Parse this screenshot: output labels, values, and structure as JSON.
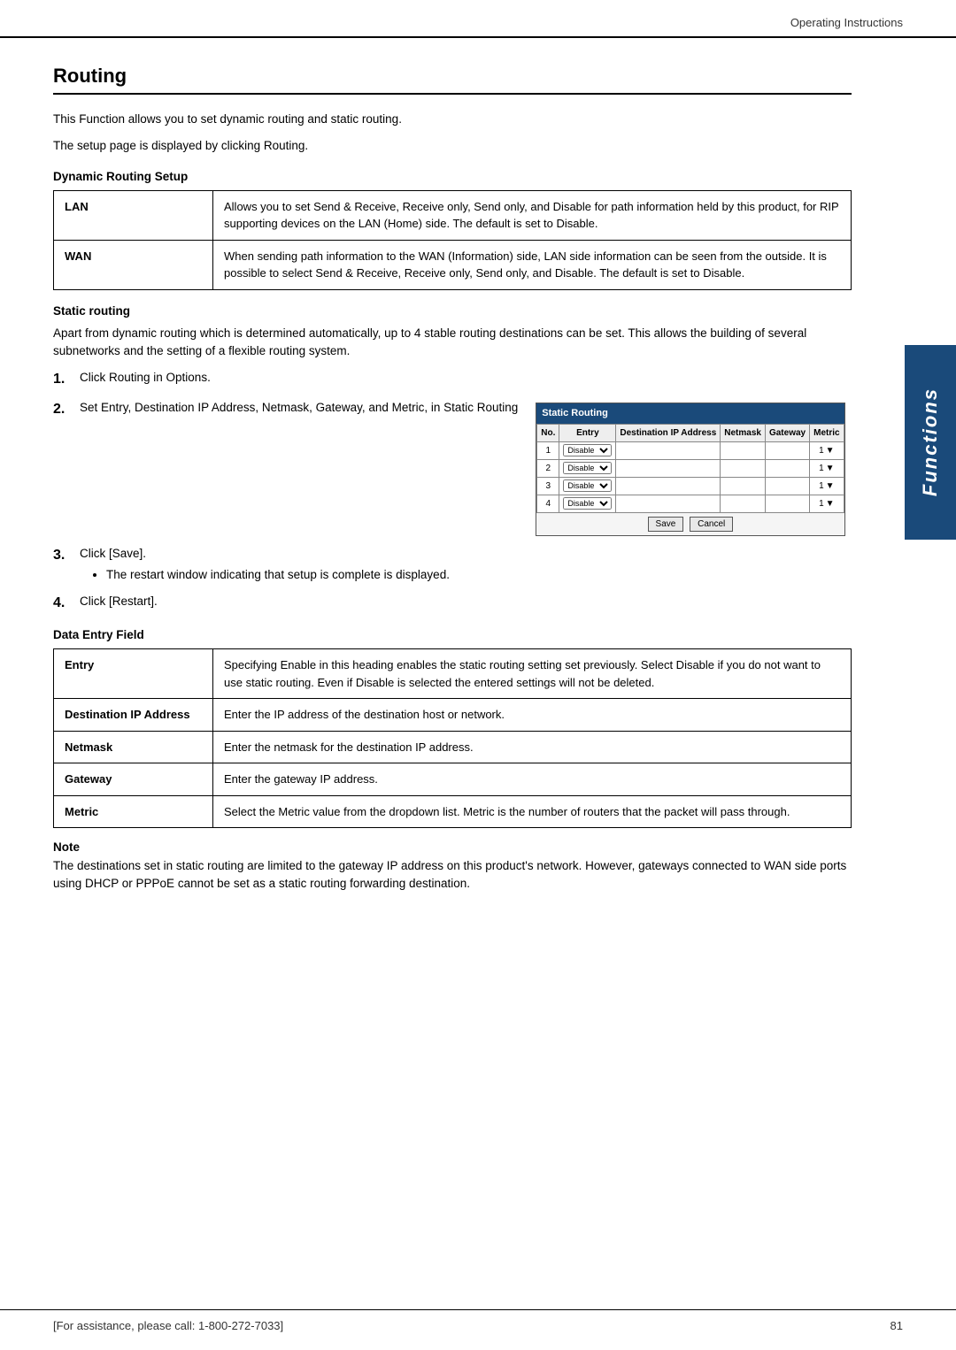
{
  "header": {
    "title": "Operating Instructions"
  },
  "side_tab": {
    "label": "Functions"
  },
  "page": {
    "title": "Routing",
    "intro1": "This Function allows you to set dynamic routing and static routing.",
    "intro2": "The setup page is displayed by clicking Routing."
  },
  "dynamic_routing": {
    "heading": "Dynamic Routing Setup",
    "rows": [
      {
        "label": "LAN",
        "description": "Allows you to set Send & Receive, Receive only, Send only, and Disable for path information held by this product, for RIP supporting devices on the LAN (Home) side. The default is set to Disable."
      },
      {
        "label": "WAN",
        "description": "When sending path information to the WAN (Information) side, LAN side information can be seen from the outside. It is possible to select Send & Receive, Receive only, Send only, and Disable. The default is set to Disable."
      }
    ]
  },
  "static_routing": {
    "heading": "Static routing",
    "description": "Apart from dynamic routing which is determined automatically, up to 4 stable routing destinations can be set. This allows the building of several subnetworks and the setting of a flexible routing system.",
    "steps": [
      {
        "number": "1.",
        "text": "Click Routing in Options."
      },
      {
        "number": "2.",
        "text": "Set Entry, Destination IP Address, Netmask, Gateway, and Metric, in Static Routing"
      },
      {
        "number": "3.",
        "text": "Click [Save].",
        "bullet": "The restart window indicating that setup is complete is displayed."
      },
      {
        "number": "4.",
        "text": "Click [Restart]."
      }
    ],
    "mini_table": {
      "title": "Static Routing",
      "columns": [
        "No.",
        "Entry",
        "Destination IP Address",
        "Netmask",
        "Gateway",
        "Metric"
      ],
      "rows": [
        {
          "no": "1",
          "entry": "Disable",
          "dest": "",
          "netmask": "",
          "gateway": "",
          "metric": "1"
        },
        {
          "no": "2",
          "entry": "Disable",
          "dest": "",
          "netmask": "",
          "gateway": "",
          "metric": "1"
        },
        {
          "no": "3",
          "entry": "Disable",
          "dest": "",
          "netmask": "",
          "gateway": "",
          "metric": "1"
        },
        {
          "no": "4",
          "entry": "Disable",
          "dest": "",
          "netmask": "",
          "gateway": "",
          "metric": "1"
        }
      ],
      "save_btn": "Save",
      "cancel_btn": "Cancel"
    }
  },
  "data_entry": {
    "heading": "Data Entry Field",
    "rows": [
      {
        "label": "Entry",
        "description": "Specifying Enable in this heading enables the static routing setting set previously. Select Disable if you do not want to use static routing. Even if Disable is selected the entered settings will not be deleted."
      },
      {
        "label": "Destination IP Address",
        "description": "Enter the IP address of the destination host or network."
      },
      {
        "label": "Netmask",
        "description": "Enter the netmask for the destination IP address."
      },
      {
        "label": "Gateway",
        "description": "Enter the gateway IP address."
      },
      {
        "label": "Metric",
        "description": "Select the Metric value from the dropdown list. Metric is the number of routers that the packet will pass through."
      }
    ]
  },
  "note": {
    "title": "Note",
    "text": "The destinations set in static routing are limited to the gateway IP address on this product's network. However, gateways connected to WAN side ports using DHCP or PPPoE cannot be set as a static routing forwarding destination."
  },
  "footer": {
    "support": "[For assistance, please call: 1-800-272-7033]",
    "page_number": "81"
  }
}
